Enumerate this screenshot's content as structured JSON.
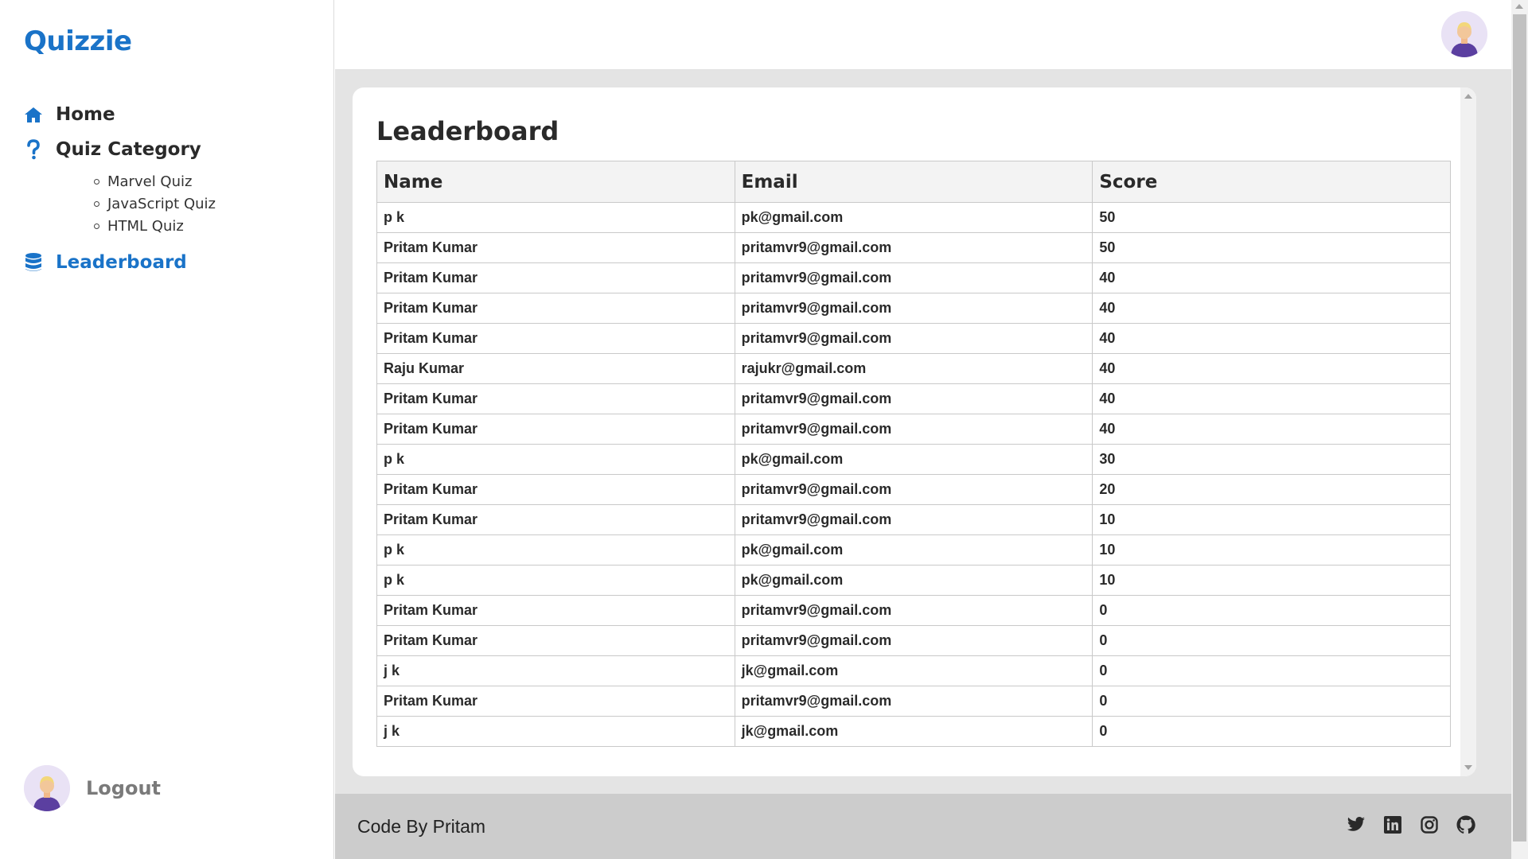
{
  "app": {
    "brand": "Quizzie"
  },
  "sidebar": {
    "items": [
      {
        "label": "Home",
        "icon": "home-icon"
      },
      {
        "label": "Quiz Category",
        "icon": "question-icon",
        "sub_items": [
          "Marvel Quiz",
          "JavaScript Quiz",
          "HTML Quiz"
        ]
      },
      {
        "label": "Leaderboard",
        "icon": "database-icon",
        "active": true
      }
    ],
    "logout_label": "Logout"
  },
  "leaderboard": {
    "title": "Leaderboard",
    "columns": [
      "Name",
      "Email",
      "Score"
    ],
    "rows": [
      [
        "p k",
        "pk@gmail.com",
        "50"
      ],
      [
        "Pritam Kumar",
        "pritamvr9@gmail.com",
        "50"
      ],
      [
        "Pritam Kumar",
        "pritamvr9@gmail.com",
        "40"
      ],
      [
        "Pritam Kumar",
        "pritamvr9@gmail.com",
        "40"
      ],
      [
        "Pritam Kumar",
        "pritamvr9@gmail.com",
        "40"
      ],
      [
        "Raju Kumar",
        "rajukr@gmail.com",
        "40"
      ],
      [
        "Pritam Kumar",
        "pritamvr9@gmail.com",
        "40"
      ],
      [
        "Pritam Kumar",
        "pritamvr9@gmail.com",
        "40"
      ],
      [
        "p k",
        "pk@gmail.com",
        "30"
      ],
      [
        "Pritam Kumar",
        "pritamvr9@gmail.com",
        "20"
      ],
      [
        "Pritam Kumar",
        "pritamvr9@gmail.com",
        "10"
      ],
      [
        "p k",
        "pk@gmail.com",
        "10"
      ],
      [
        "p k",
        "pk@gmail.com",
        "10"
      ],
      [
        "Pritam Kumar",
        "pritamvr9@gmail.com",
        "0"
      ],
      [
        "Pritam Kumar",
        "pritamvr9@gmail.com",
        "0"
      ],
      [
        "j k",
        "jk@gmail.com",
        "0"
      ],
      [
        "Pritam Kumar",
        "pritamvr9@gmail.com",
        "0"
      ],
      [
        "j k",
        "jk@gmail.com",
        "0"
      ]
    ]
  },
  "footer": {
    "credit": "Code By Pritam",
    "social": [
      "twitter-icon",
      "linkedin-icon",
      "instagram-icon",
      "github-icon"
    ]
  },
  "colors": {
    "accent": "#1a73c8",
    "main_bg": "#e4e4e4",
    "footer_bg": "#cccccc"
  }
}
